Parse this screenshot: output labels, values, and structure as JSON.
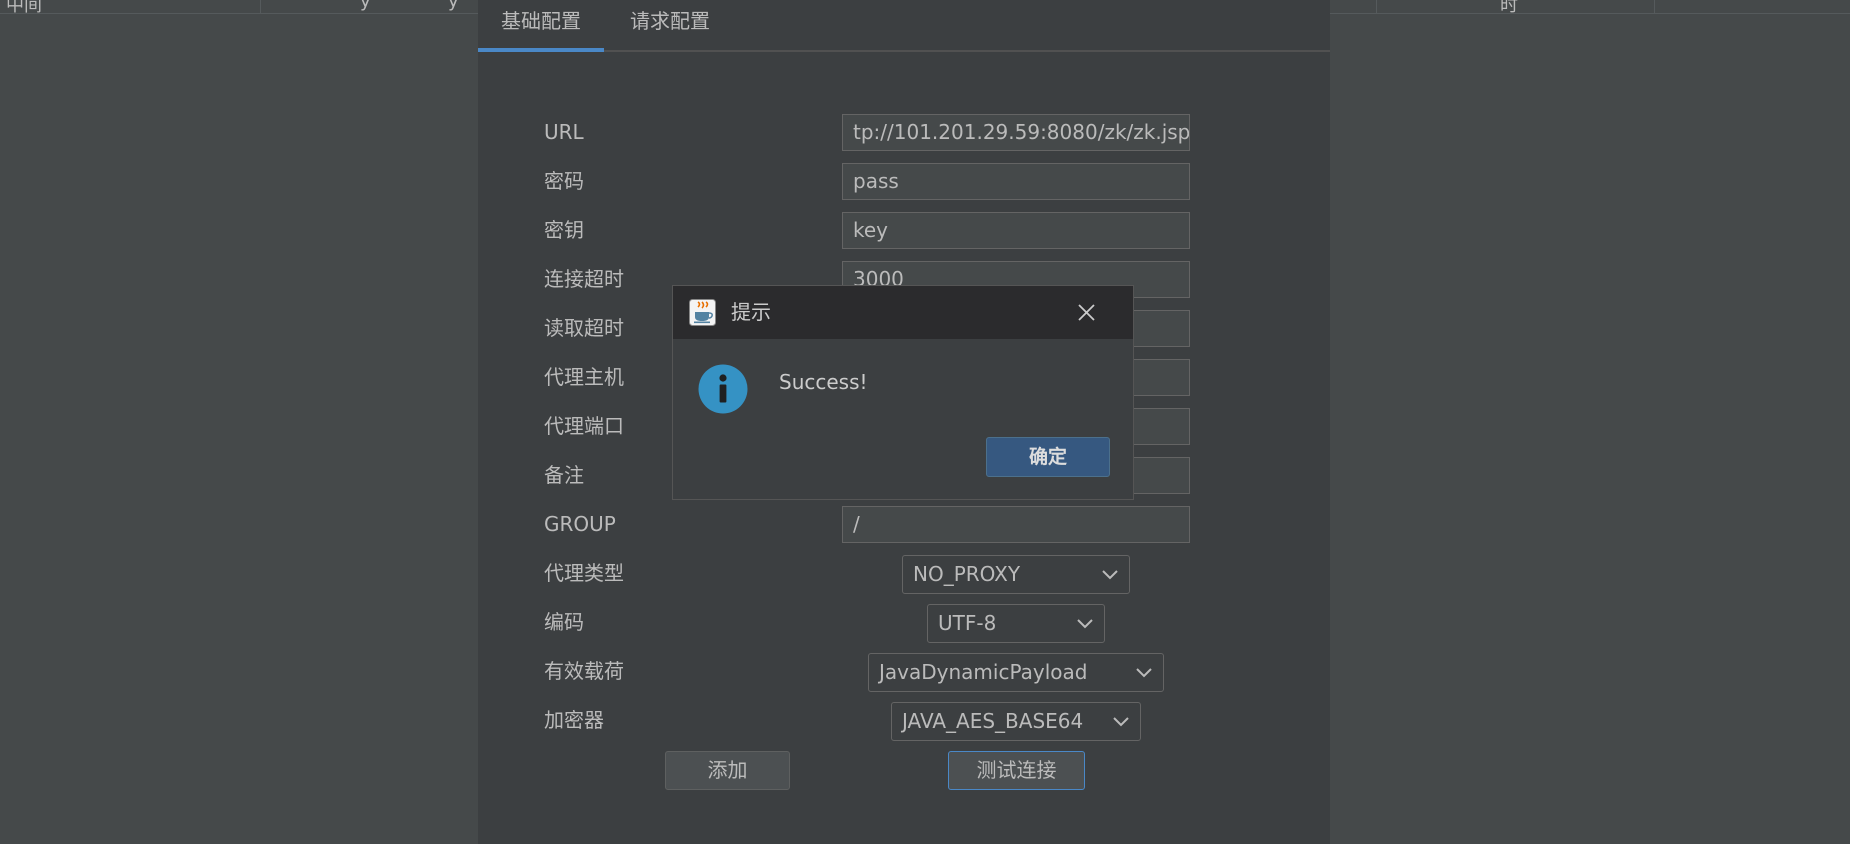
{
  "background": {
    "header_fragments": [
      "中间",
      "y",
      "y",
      "时"
    ]
  },
  "tabs": [
    {
      "label": "基础配置",
      "active": true
    },
    {
      "label": "请求配置",
      "active": false
    }
  ],
  "form": {
    "url": {
      "label": "URL",
      "value": "tp://101.201.29.59:8080/zk/zk.jsp"
    },
    "password": {
      "label": "密码",
      "value": "pass"
    },
    "secret_key": {
      "label": "密钥",
      "value": "key"
    },
    "connect_timeout": {
      "label": "连接超时",
      "value": "3000"
    },
    "read_timeout": {
      "label": "读取超时",
      "value": ""
    },
    "proxy_host": {
      "label": "代理主机",
      "value": ""
    },
    "proxy_port": {
      "label": "代理端口",
      "value": ""
    },
    "remark": {
      "label": "备注",
      "value": ""
    },
    "group": {
      "label": "GROUP",
      "value": "/"
    },
    "proxy_type": {
      "label": "代理类型",
      "value": "NO_PROXY"
    },
    "encoding": {
      "label": "编码",
      "value": "UTF-8"
    },
    "payload": {
      "label": "有效载荷",
      "value": "JavaDynamicPayload"
    },
    "encryptor": {
      "label": "加密器",
      "value": "JAVA_AES_BASE64"
    }
  },
  "buttons": {
    "add": "添加",
    "test_connection": "测试连接"
  },
  "dialog": {
    "title": "提示",
    "message": "Success!",
    "ok_label": "确定",
    "icon": "info-icon",
    "title_icon": "java-icon"
  },
  "colors": {
    "accent": "#4a88c7",
    "info_icon": "#3592c4",
    "ok_button": "#365880"
  }
}
